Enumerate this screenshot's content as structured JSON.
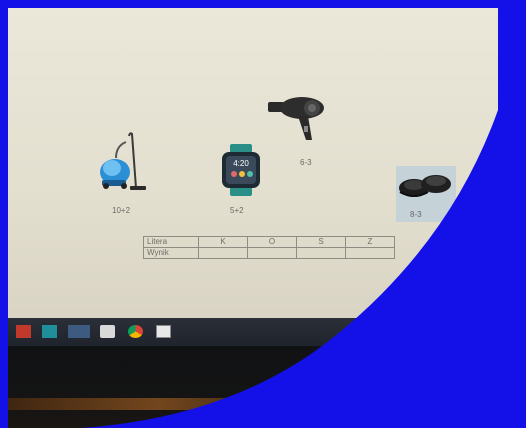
{
  "screen": {
    "items": [
      {
        "name": "vacuum-cleaner",
        "label": "10+2"
      },
      {
        "name": "smartwatch",
        "label": "5+2",
        "watch_time": "4:20"
      },
      {
        "name": "hair-dryer",
        "label": "6-3"
      },
      {
        "name": "shoes",
        "label": "8-3"
      }
    ],
    "table": {
      "row1_header": "Litera",
      "row2_header": "Wynik",
      "letters": [
        "K",
        "O",
        "S",
        "Z"
      ]
    }
  },
  "taskbar": {
    "icons": [
      "red-app-icon",
      "phone-app-icon",
      "store-app-icon",
      "mail-app-icon",
      "chrome-app-icon",
      "photos-app-icon"
    ]
  },
  "colors": {
    "overlay_blue": "#1410e8",
    "screen_bg": "#e8e4d6",
    "taskbar": "#262a33"
  }
}
